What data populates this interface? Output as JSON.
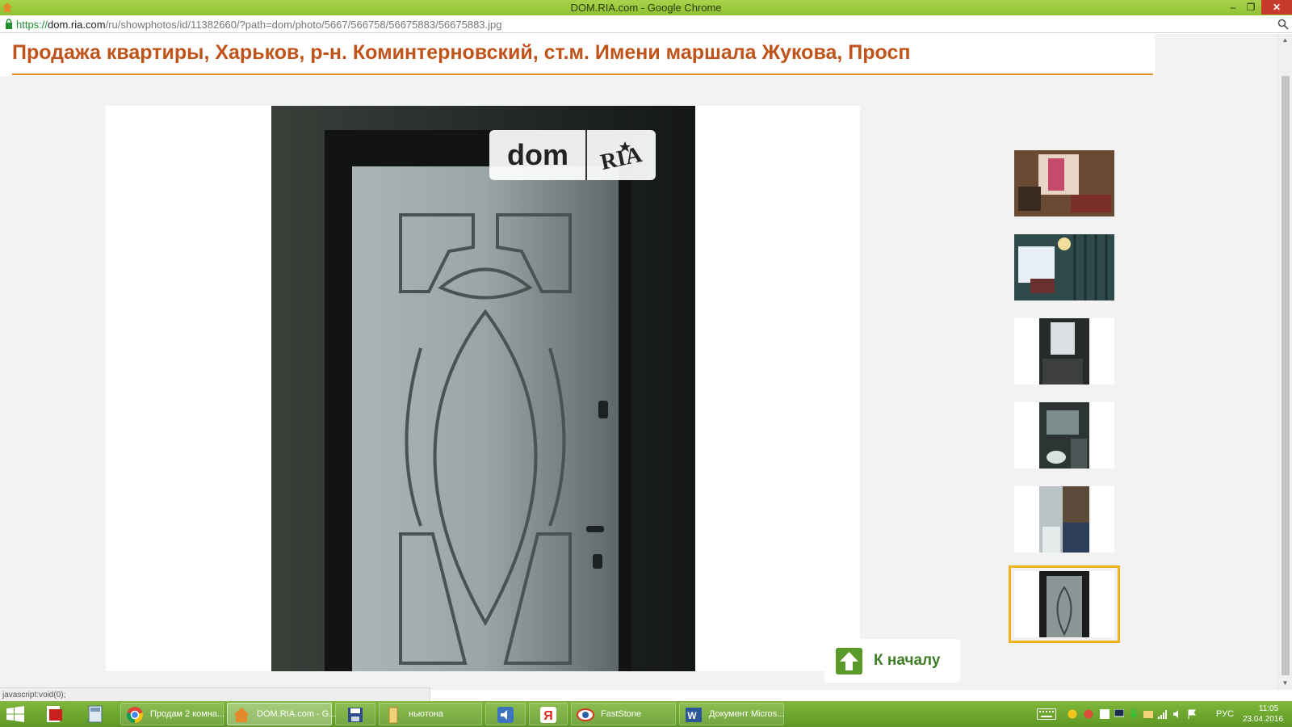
{
  "window": {
    "title": "DOM.RIA.com - Google Chrome",
    "minimize": "–",
    "maximize": "❐",
    "close": "✕"
  },
  "address_bar": {
    "url_scheme": "https://",
    "url_host": "dom.ria.com",
    "url_path": "/ru/showphotos/id/11382660/?path=dom/photo/5667/566758/56675883/56675883.jpg"
  },
  "page": {
    "title": "Продажа квартиры, Харьков, р-н. Коминтерновский, ст.м. Имени маршала Жукова, Просп",
    "watermark_left": "dom",
    "watermark_right": "RIA",
    "to_top_label": "К началу",
    "thumbnails": [
      {
        "name": "room-with-window",
        "selected": false
      },
      {
        "name": "room-with-chandelier",
        "selected": false
      },
      {
        "name": "doorway-window",
        "selected": false
      },
      {
        "name": "bathroom",
        "selected": false
      },
      {
        "name": "kitchen",
        "selected": false
      },
      {
        "name": "front-door",
        "selected": true
      }
    ]
  },
  "status_text": "javascript:void(0);",
  "taskbar": {
    "items": [
      {
        "label": "Продам 2 комна...",
        "state": "open",
        "icon": "chrome-icon"
      },
      {
        "label": "DOM.RIA.com - G...",
        "state": "active",
        "icon": "domria-icon"
      },
      {
        "label": "",
        "state": "pinned",
        "icon": "floppy-icon"
      },
      {
        "label": "ньютона",
        "state": "open",
        "icon": "folder-icon"
      },
      {
        "label": "",
        "state": "pinned",
        "icon": "speaker-app-icon"
      },
      {
        "label": "",
        "state": "pinned",
        "icon": "yandex-icon"
      },
      {
        "label": "FastStone",
        "state": "open",
        "icon": "faststone-icon"
      },
      {
        "label": "Документ Micros...",
        "state": "open",
        "icon": "word-icon"
      }
    ],
    "language": "РУС",
    "time": "11:05",
    "date": "23.04.2016"
  },
  "colors": {
    "titlebar": "#8fc232",
    "page_title": "#c0531a",
    "title_rule": "#e58a28",
    "selected_thumb": "#f2b21b",
    "to_top_text": "#3f7e26"
  }
}
